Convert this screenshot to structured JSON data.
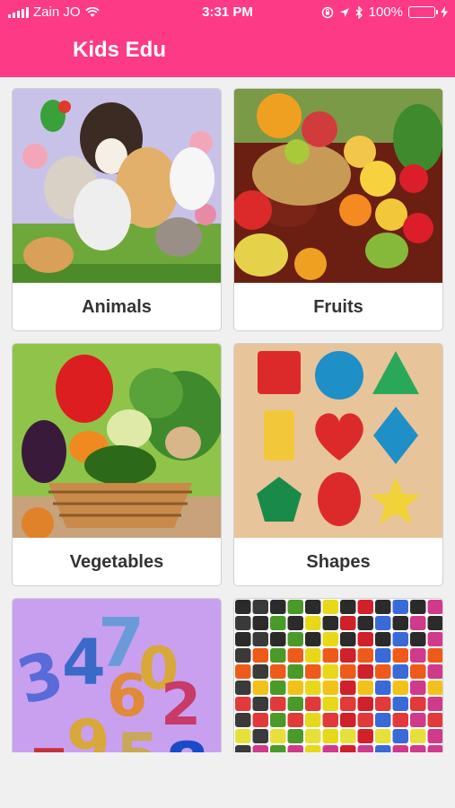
{
  "status_bar": {
    "carrier": "Zain JO",
    "time": "3:31 PM",
    "battery": "100%",
    "battery_level": 1.0,
    "icons": [
      "signal-icon",
      "wifi-icon",
      "lock-rotation-icon",
      "location-icon",
      "bluetooth-icon",
      "battery-icon",
      "charging-icon"
    ]
  },
  "app": {
    "title": "Kids Edu",
    "header_color": "#fd3a85"
  },
  "categories": [
    {
      "label": "Animals",
      "image": "animals-image"
    },
    {
      "label": "Fruits",
      "image": "fruits-image"
    },
    {
      "label": "Vegetables",
      "image": "vegetables-image"
    },
    {
      "label": "Shapes",
      "image": "shapes-image"
    },
    {
      "label": "",
      "image": "numbers-image"
    },
    {
      "label": "",
      "image": "colors-image"
    }
  ]
}
